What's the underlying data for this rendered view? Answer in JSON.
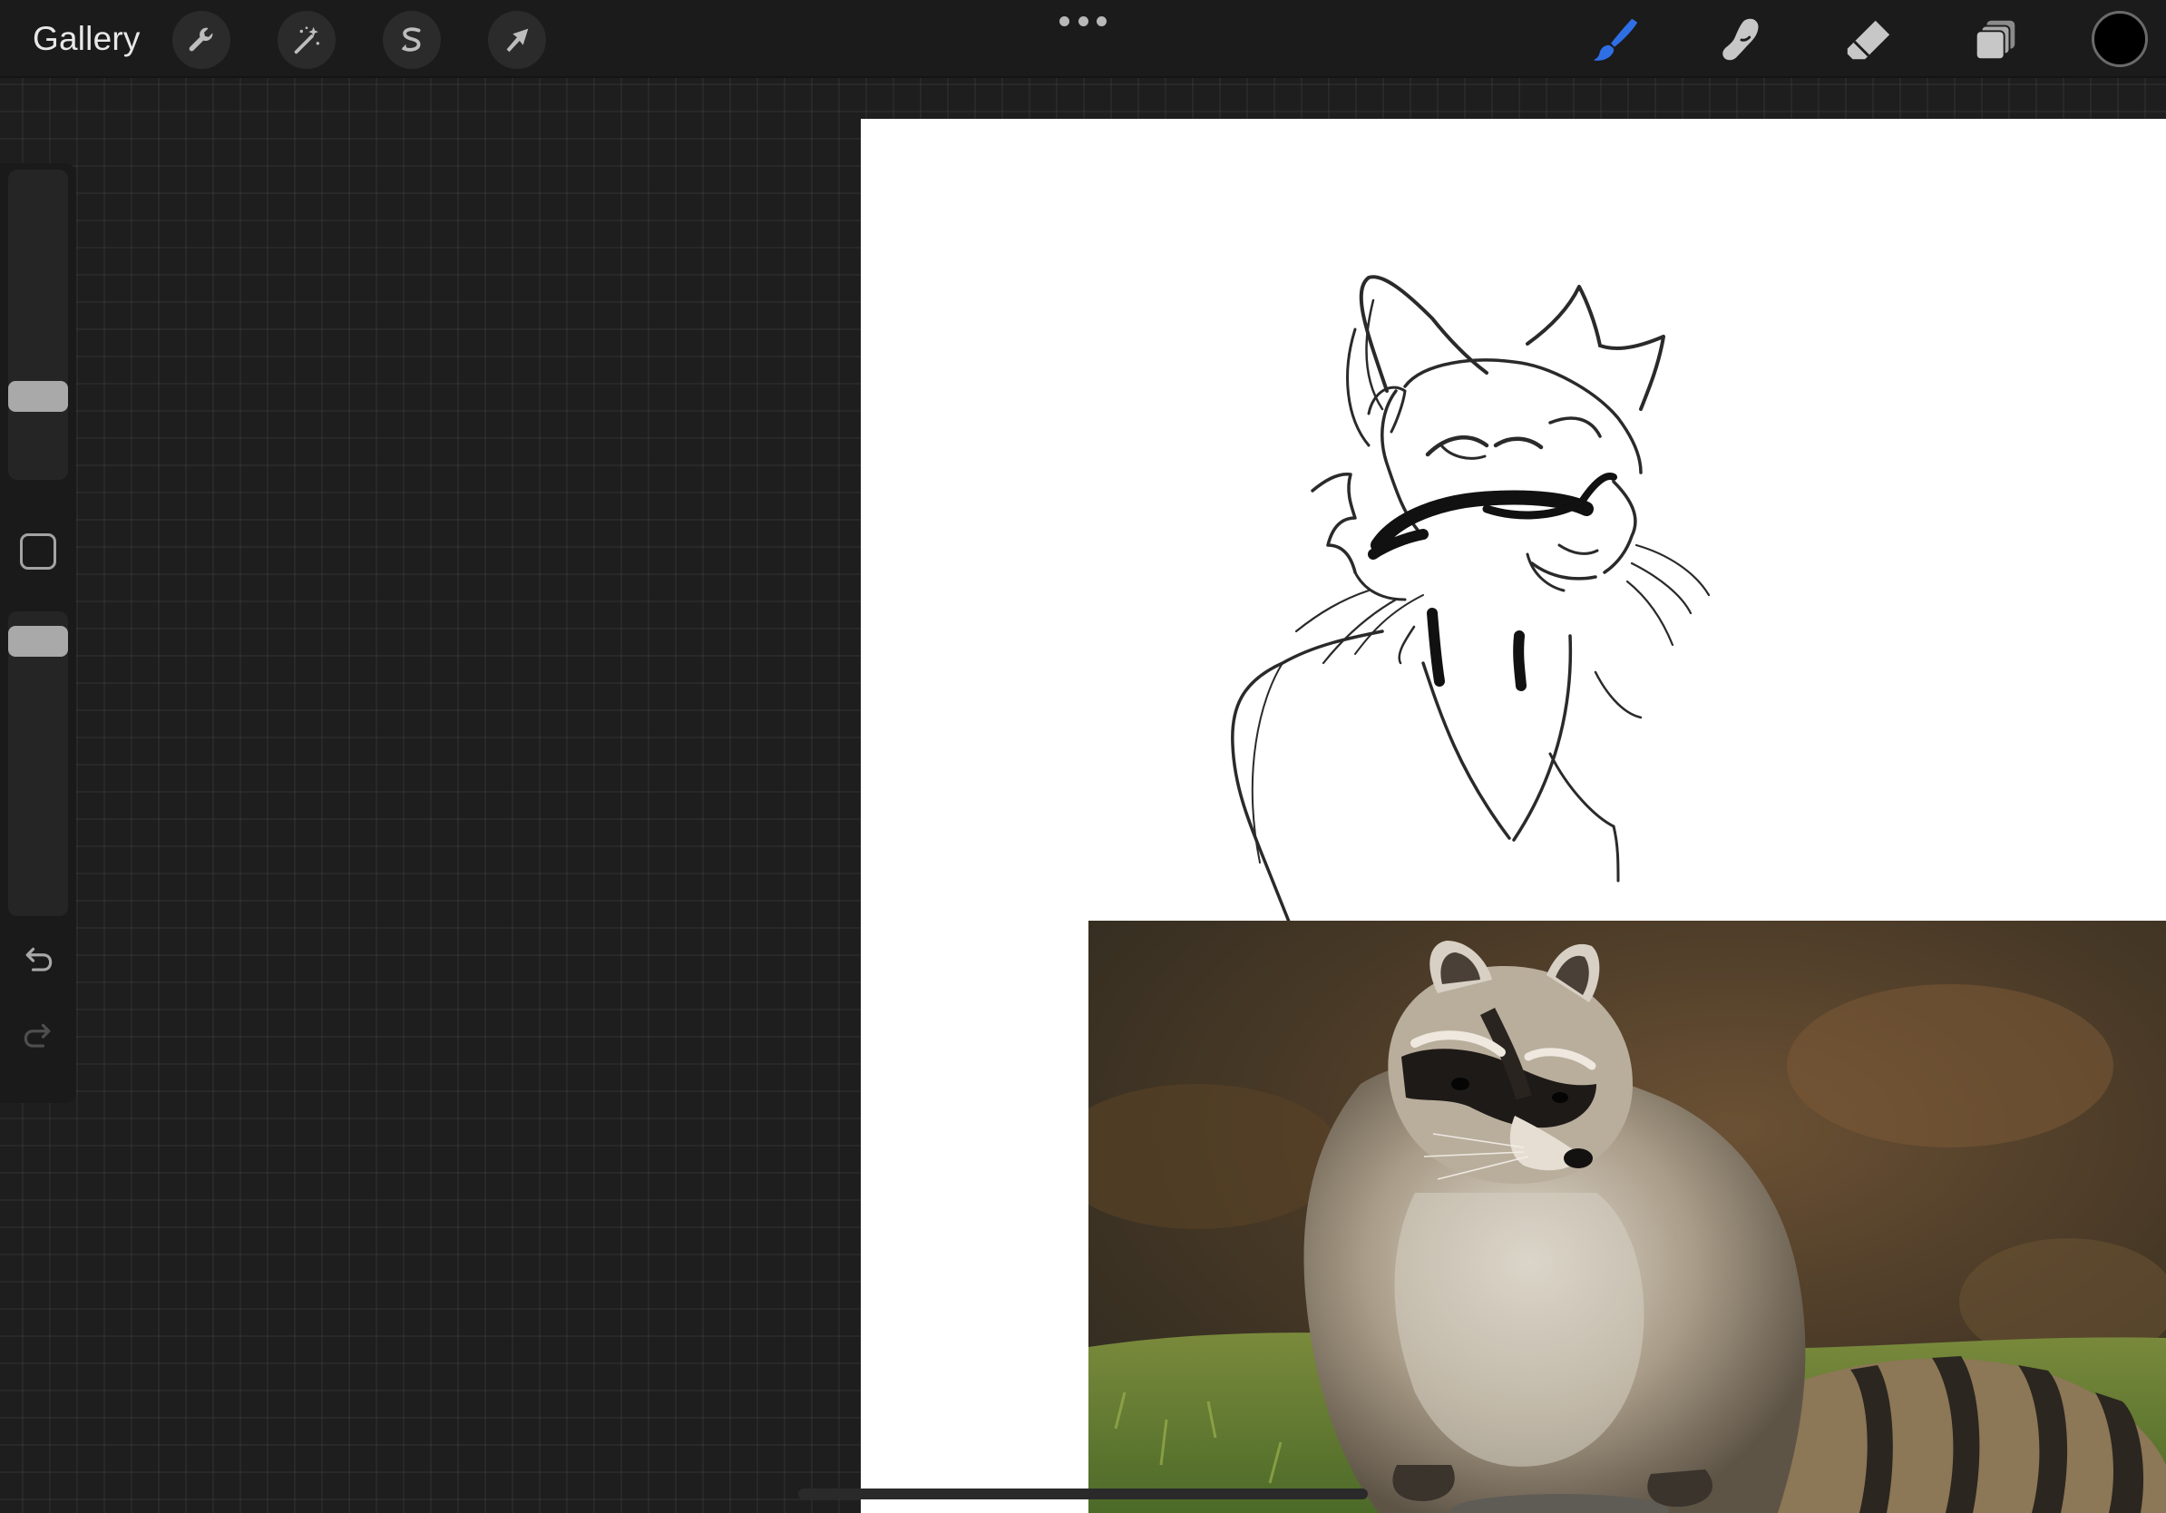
{
  "topbar": {
    "gallery_label": "Gallery",
    "left_tools": [
      {
        "name": "actions",
        "icon": "wrench-icon"
      },
      {
        "name": "adjustments",
        "icon": "magic-wand-icon"
      },
      {
        "name": "selection",
        "icon": "selection-s-icon"
      },
      {
        "name": "transform",
        "icon": "arrow-cursor-icon"
      }
    ],
    "more_menu_icon": "ellipsis-icon",
    "right_tools": [
      {
        "name": "brush",
        "icon": "brush-icon",
        "active": true
      },
      {
        "name": "smudge",
        "icon": "smudge-finger-icon",
        "active": false
      },
      {
        "name": "eraser",
        "icon": "eraser-icon",
        "active": false
      },
      {
        "name": "layers",
        "icon": "layers-icon",
        "active": false
      }
    ],
    "current_color": "#000000",
    "active_tool_color": "#2f6fe6"
  },
  "sidebar": {
    "brush_size_level": 0.7,
    "opacity_level": 1.0,
    "modify_button_icon": "square-outline-icon",
    "undo_icon": "undo-icon",
    "redo_icon": "redo-icon",
    "redo_enabled": false
  },
  "canvas": {
    "background": "#ffffff",
    "sketch_subject": "raccoon-sketch",
    "reference_photo": "raccoon-reference-photo"
  }
}
